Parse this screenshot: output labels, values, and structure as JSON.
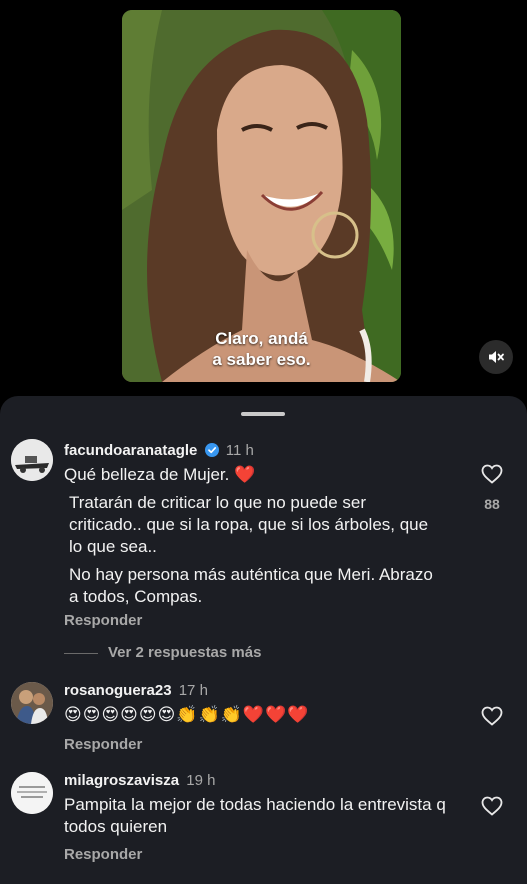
{
  "video": {
    "caption_lines": [
      "Claro, andá",
      "a saber eso."
    ],
    "mute_icon": "speaker-muted-icon"
  },
  "comments": [
    {
      "username": "facundoaranatagle",
      "verified": true,
      "time": "11 h",
      "paragraphs": [
        "Qué belleza de Mujer. ❤️",
        "Tratarán de criticar lo que no puede ser criticado.. que si la ropa, que si los árboles, que lo que sea..",
        "No hay persona más auténtica que Meri. Abrazo a todos, Compas."
      ],
      "likes": "88",
      "reply_label": "Responder",
      "view_replies": "Ver 2 respuestas más"
    },
    {
      "username": "rosanoguera23",
      "verified": false,
      "time": "17 h",
      "paragraphs": [
        "😍😍😍😍😍😍👏👏👏❤️❤️❤️"
      ],
      "reply_label": "Responder"
    },
    {
      "username": "milagroszavisza",
      "verified": false,
      "time": "19 h",
      "paragraphs": [
        "Pampita la mejor de todas haciendo la entrevista q todos quieren"
      ],
      "reply_label": "Responder"
    }
  ],
  "colors": {
    "sheet_bg": "#1c1e24",
    "verified_blue": "#3897f0",
    "secondary_text": "#a8a8a8"
  }
}
